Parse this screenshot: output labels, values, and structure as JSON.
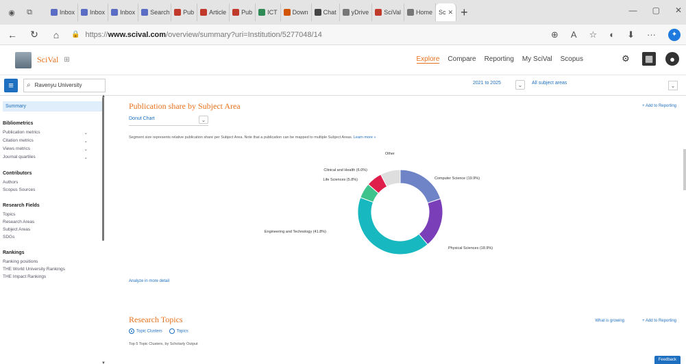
{
  "browser": {
    "tabs": [
      {
        "label": "Inbox",
        "color": "#5b6cc4"
      },
      {
        "label": "Inbox",
        "color": "#5b6cc4"
      },
      {
        "label": "Inbox",
        "color": "#5b6cc4"
      },
      {
        "label": "Search",
        "color": "#5b6cc4"
      },
      {
        "label": "Pub",
        "color": "#c0392b"
      },
      {
        "label": "Article",
        "color": "#c0392b"
      },
      {
        "label": "Pub",
        "color": "#c0392b"
      },
      {
        "label": "ICT",
        "color": "#2e8b57"
      },
      {
        "label": "Down",
        "color": "#d35400"
      },
      {
        "label": "Chat",
        "color": "#444"
      },
      {
        "label": "yDrive",
        "color": "#777"
      },
      {
        "label": "SciVal",
        "color": "#c0392b"
      },
      {
        "label": "Home",
        "color": "#777"
      }
    ],
    "active_tab": "Sc",
    "url_prefix": "https://",
    "url_host": "www.scival.com",
    "url_path": "/overview/summary?uri=Institution/5277048/14"
  },
  "app": {
    "logo_text": "SciVal",
    "nav": [
      "Explore",
      "Compare",
      "Reporting",
      "My SciVal",
      "Scopus"
    ],
    "active_nav": "Explore"
  },
  "subbar": {
    "entity": "Ravenyu University",
    "date_range": "2021 to 2025",
    "subject": "All subject areas"
  },
  "sidebar": {
    "summary": "Summary",
    "sections": [
      {
        "head": "Bibliometrics",
        "items": [
          "Publication metrics",
          "Citation metrics",
          "Views metrics",
          "Journal quartiles"
        ]
      },
      {
        "head": "Contributors",
        "items": [
          "Authors",
          "Scopus Sources"
        ]
      },
      {
        "head": "Research Fields",
        "items": [
          "Topics",
          "Research Areas",
          "Subject Areas",
          "SDGs"
        ]
      },
      {
        "head": "Rankings",
        "items": [
          "Ranking positions",
          "THE World University Rankings",
          "THE Impact Rankings"
        ]
      }
    ]
  },
  "publication_share": {
    "title": "Publication share by Subject Area",
    "add_to_reporting": "+ Add to Reporting",
    "chart_type": "Donut Chart",
    "description": "Segment size represents relative publication share per Subject Area. Note that a publication can be mapped to multiple Subject Areas.",
    "learn_more": "Learn more »",
    "analyze": "Analyze in more detail"
  },
  "chart_data": {
    "type": "pie",
    "style": "donut",
    "slices": [
      {
        "label": "Computer Science",
        "value": 19.9,
        "color": "#6f84c6"
      },
      {
        "label": "Physical Sciences",
        "value": 18.9,
        "color": "#7a3fb8"
      },
      {
        "label": "Engineering and Technology",
        "value": 41.8,
        "color": "#17b8bf"
      },
      {
        "label": "Life Sciences",
        "value": 5.8,
        "color": "#3fc38c"
      },
      {
        "label": "Clinical and Health",
        "value": 6.0,
        "color": "#e01e4b"
      },
      {
        "label": "Other",
        "value": 7.6,
        "color": "#dedede"
      }
    ],
    "labels_text": [
      "Computer Science (19.9%)",
      "Physical Sciences (18.9%)",
      "Engineering and Technology (41.8%)",
      "Life Sciences (5.8%)",
      "Clinical and Health (6.0%)",
      "Other"
    ]
  },
  "research_topics": {
    "title": "Research Topics",
    "what_is_growing": "What is growing",
    "add_to_reporting": "+ Add to Reporting",
    "radio_options": [
      "Topic Clusters",
      "Topics"
    ],
    "subtitle": "Top 5 Topic Clusters, by Scholarly Output"
  },
  "feedback": "Feedback"
}
